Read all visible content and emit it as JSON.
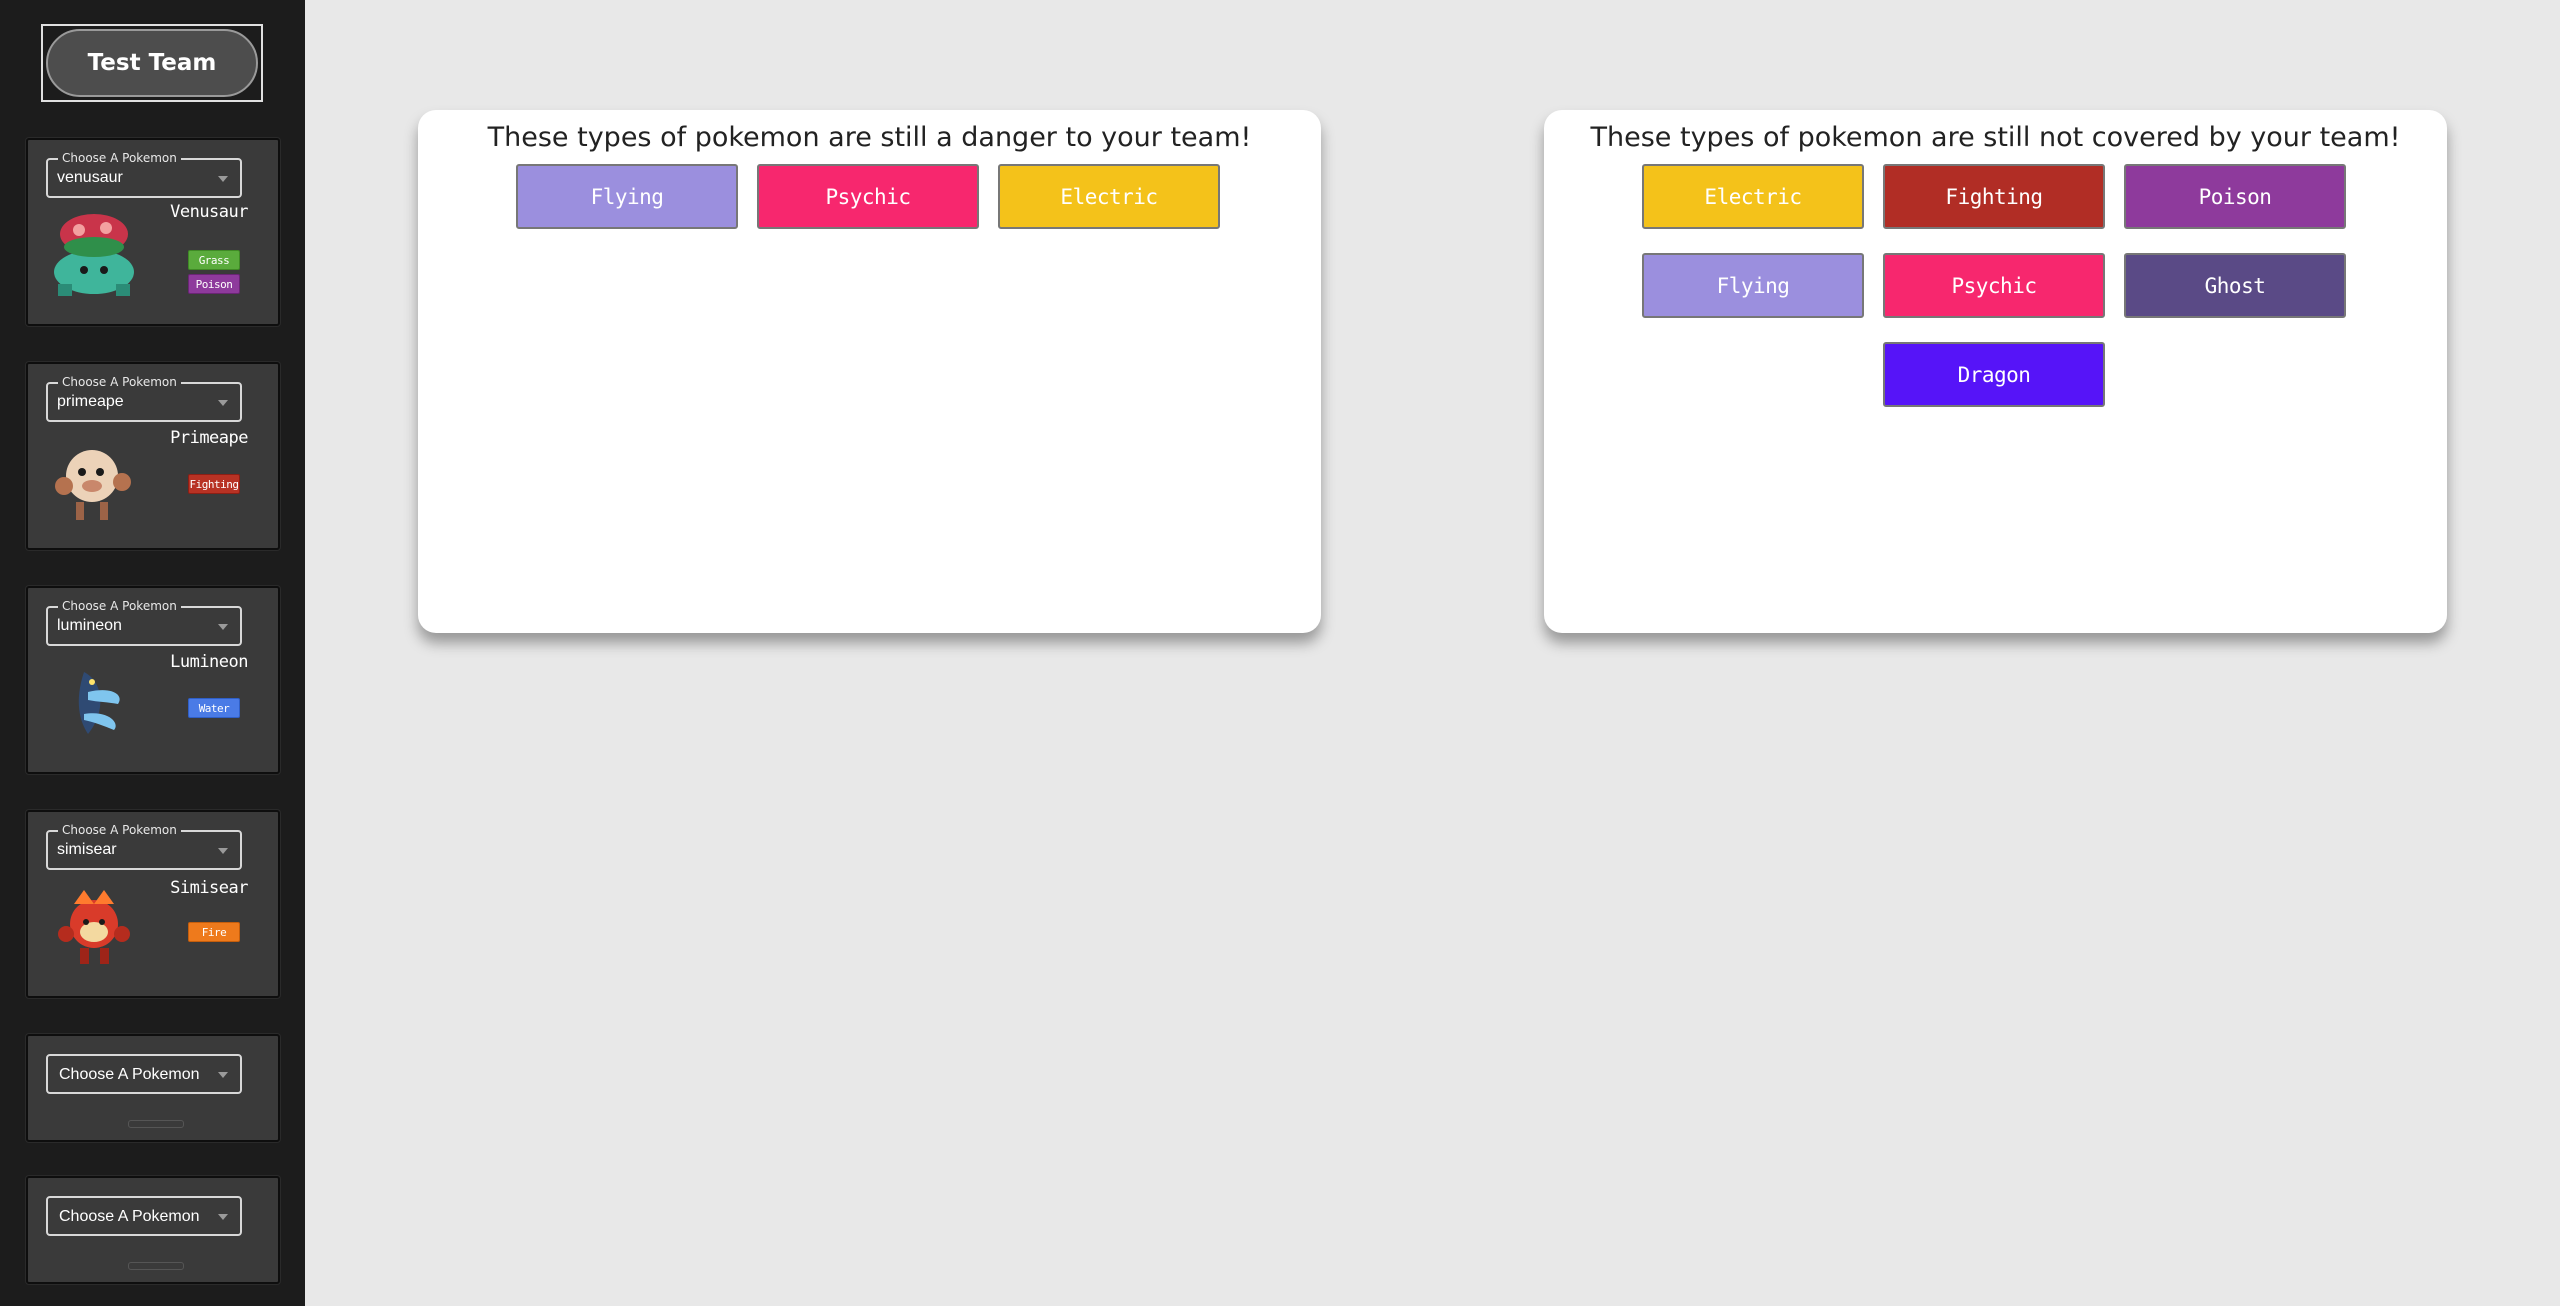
{
  "team": {
    "name": "Test Team"
  },
  "slots": [
    {
      "legend": "Choose A Pokemon",
      "value": "venusaur",
      "name": "Venusaur",
      "types": [
        "Grass",
        "Poison"
      ],
      "type_colors": [
        "#5aab3c",
        "#8e3a9c"
      ],
      "sprite": "venusaur-sprite"
    },
    {
      "legend": "Choose A Pokemon",
      "value": "primeape",
      "name": "Primeape",
      "types": [
        "Fighting"
      ],
      "type_colors": [
        "#b83224"
      ],
      "sprite": "primeape-sprite"
    },
    {
      "legend": "Choose A Pokemon",
      "value": "lumineon",
      "name": "Lumineon",
      "types": [
        "Water"
      ],
      "type_colors": [
        "#4a7be6"
      ],
      "sprite": "lumineon-sprite"
    },
    {
      "legend": "Choose A Pokemon",
      "value": "simisear",
      "name": "Simisear",
      "types": [
        "Fire"
      ],
      "type_colors": [
        "#ee7a1c"
      ],
      "sprite": "simisear-sprite"
    },
    {
      "legend": "",
      "value": "Choose A Pokemon",
      "name": "",
      "types": [],
      "type_colors": [],
      "sprite": ""
    },
    {
      "legend": "",
      "value": "Choose A Pokemon",
      "name": "",
      "types": [],
      "type_colors": [],
      "sprite": ""
    }
  ],
  "danger_panel": {
    "title": "These types of pokemon are still a danger to your team!",
    "types": [
      {
        "label": "Flying",
        "color": "#9b8fde"
      },
      {
        "label": "Psychic",
        "color": "#f7276e"
      },
      {
        "label": "Electric",
        "color": "#f4c21a"
      }
    ]
  },
  "coverage_panel": {
    "title": "These types of pokemon are still not covered by your team!",
    "types": [
      {
        "label": "Electric",
        "color": "#f4c21a"
      },
      {
        "label": "Fighting",
        "color": "#b12d25"
      },
      {
        "label": "Poison",
        "color": "#8e3a9c"
      },
      {
        "label": "Flying",
        "color": "#9b8fde"
      },
      {
        "label": "Psychic",
        "color": "#f7276e"
      },
      {
        "label": "Ghost",
        "color": "#5a4a86"
      },
      {
        "label": "Dragon",
        "color": "#5614f8"
      }
    ]
  }
}
